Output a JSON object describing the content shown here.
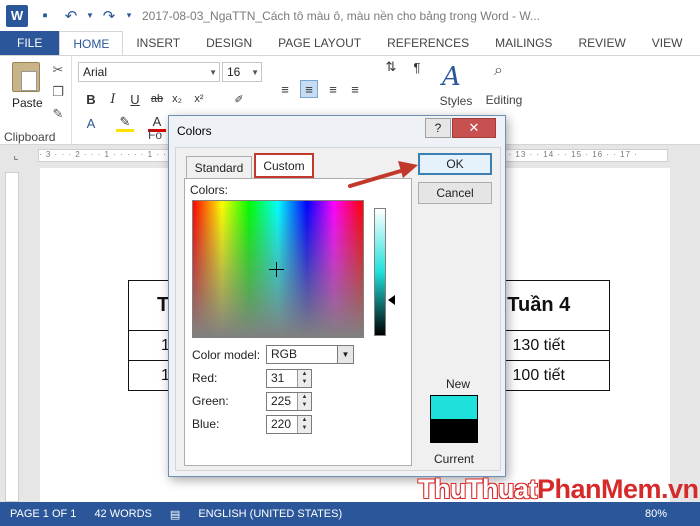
{
  "window": {
    "title": "2017-08-03_NgaTTN_Cách tô màu ô, màu nền cho bảng trong Word - W..."
  },
  "tabs": [
    {
      "label": "FILE"
    },
    {
      "label": "HOME"
    },
    {
      "label": "INSERT"
    },
    {
      "label": "DESIGN"
    },
    {
      "label": "PAGE LAYOUT"
    },
    {
      "label": "REFERENCES"
    },
    {
      "label": "MAILINGS"
    },
    {
      "label": "REVIEW"
    },
    {
      "label": "VIEW"
    }
  ],
  "ribbon": {
    "paste_label": "Paste",
    "clipboard_label": "Clipboard",
    "font_group_label": "Fo",
    "font_name": "Arial",
    "font_size": "16",
    "styles_label": "Styles",
    "editing_label": "Editing"
  },
  "document": {
    "table": {
      "header": [
        "T",
        "Tuần 4"
      ],
      "rows": [
        [
          "1",
          "130 tiết"
        ],
        [
          "1",
          "100 tiết"
        ]
      ]
    }
  },
  "dialog": {
    "title": "Colors",
    "help_label": "?",
    "close_label": "✕",
    "tab_standard": "Standard",
    "tab_custom": "Custom",
    "colors_label": "Colors:",
    "color_model_label": "Color model:",
    "color_model_value": "RGB",
    "red_label": "Red:",
    "red_value": "31",
    "green_label": "Green:",
    "green_value": "225",
    "blue_label": "Blue:",
    "blue_value": "220",
    "ok_label": "OK",
    "cancel_label": "Cancel",
    "new_label": "New",
    "current_label": "Current",
    "new_color": "#1fe1dc",
    "current_color": "#000000"
  },
  "statusbar": {
    "page": "PAGE 1 OF 1",
    "words": "42 WORDS",
    "language": "ENGLISH (UNITED STATES)",
    "zoom": "80%"
  },
  "watermark": {
    "part1": "ThuThuat",
    "part2": "PhanMem.vn"
  },
  "colors": {
    "accent": "#2b579a",
    "highlight": "#c0392b"
  }
}
